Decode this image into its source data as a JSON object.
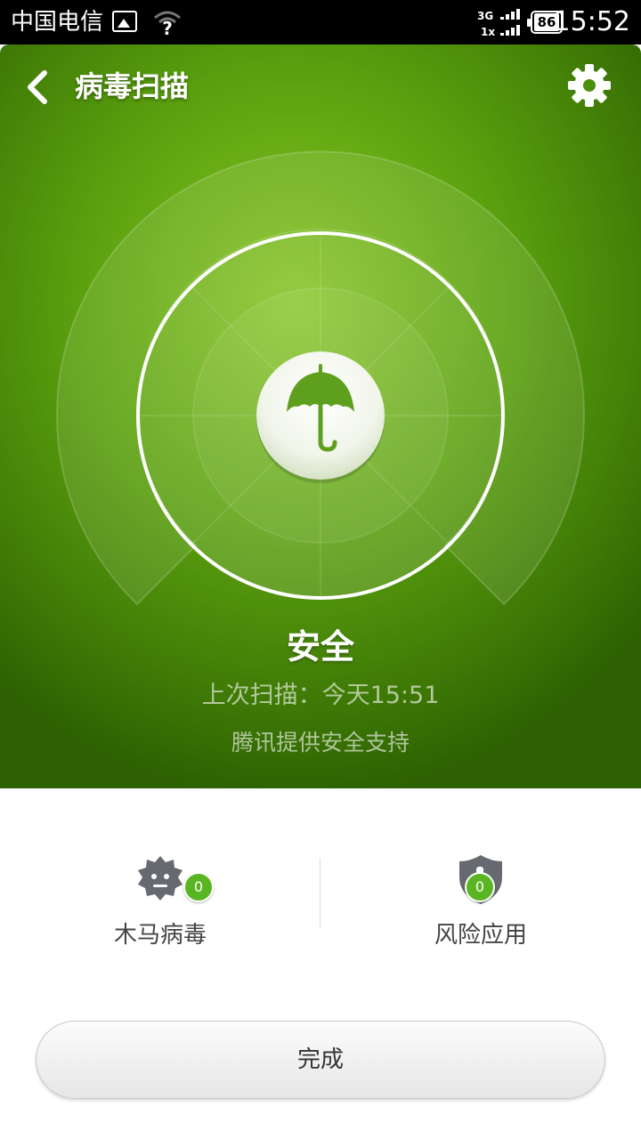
{
  "status_bar": {
    "carrier": "中国电信",
    "network_top": "3G",
    "network_bottom": "1x",
    "battery": "86",
    "time": "15:52"
  },
  "header": {
    "title": "病毒扫描",
    "back_icon": "chevron-left-icon",
    "settings_icon": "gear-icon"
  },
  "scan": {
    "center_icon": "umbrella-icon",
    "status": "安全",
    "last_scan": "上次扫描：今天15:51",
    "support": "腾讯提供安全支持"
  },
  "stats": [
    {
      "label": "木马病毒",
      "count": "0",
      "icon": "virus-gear-icon"
    },
    {
      "label": "风险应用",
      "count": "0",
      "icon": "shield-alert-icon"
    }
  ],
  "actions": {
    "done": "完成"
  },
  "colors": {
    "accent_green": "#5ca20f",
    "badge_green": "#5ab522",
    "status_bar": "#000000"
  }
}
